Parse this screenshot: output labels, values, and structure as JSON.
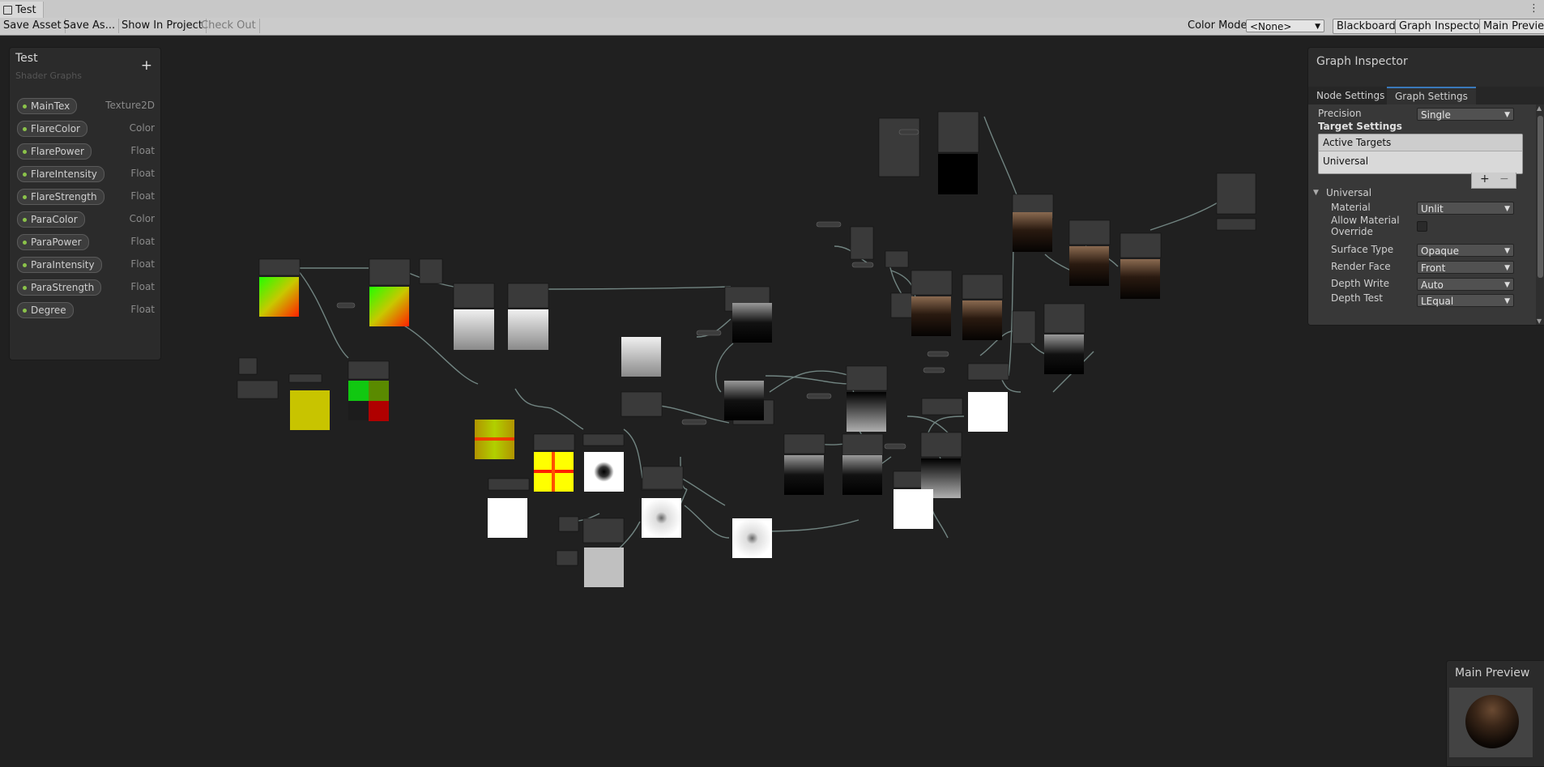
{
  "window": {
    "tab_title": "Test"
  },
  "toolbar": {
    "save_asset": "Save Asset",
    "save_as": "Save As...",
    "show_in_project": "Show In Project",
    "check_out": "Check Out",
    "color_mode_label": "Color Mode",
    "color_mode_value": "<None>",
    "blackboard": "Blackboard",
    "graph_inspector": "Graph Inspector",
    "main_preview": "Main Preview"
  },
  "blackboard": {
    "title": "Test",
    "subtitle": "Shader Graphs",
    "add": "+",
    "properties": [
      {
        "name": "MainTex",
        "type": "Texture2D"
      },
      {
        "name": "FlareColor",
        "type": "Color"
      },
      {
        "name": "FlarePower",
        "type": "Float"
      },
      {
        "name": "FlareIntensity",
        "type": "Float"
      },
      {
        "name": "FlareStrength",
        "type": "Float"
      },
      {
        "name": "ParaColor",
        "type": "Color"
      },
      {
        "name": "ParaPower",
        "type": "Float"
      },
      {
        "name": "ParaIntensity",
        "type": "Float"
      },
      {
        "name": "ParaStrength",
        "type": "Float"
      },
      {
        "name": "Degree",
        "type": "Float"
      }
    ]
  },
  "inspector": {
    "title": "Graph Inspector",
    "tabs": [
      "Node Settings",
      "Graph Settings"
    ],
    "active_tab": "Graph Settings",
    "precision_label": "Precision",
    "precision_value": "Single",
    "target_settings": "Target Settings",
    "active_targets": "Active Targets",
    "target_item": "Universal",
    "plus": "+",
    "minus": "−",
    "section": "Universal",
    "fields": [
      {
        "label": "Material",
        "value": "Unlit"
      },
      {
        "label": "Allow Material Override",
        "value": ""
      },
      {
        "label": "Surface Type",
        "value": "Opaque"
      },
      {
        "label": "Render Face",
        "value": "Front"
      },
      {
        "label": "Depth Write",
        "value": "Auto"
      },
      {
        "label": "Depth Test",
        "value": "LEqual"
      }
    ],
    "allow_override_checked": false
  },
  "preview": {
    "title": "Main Preview"
  },
  "colors": {
    "canvas": "#202020",
    "panel": "#2b2b2b",
    "edge": "#6e8f8a",
    "accent": "#3a79bb",
    "property_dot": "#8bc34a"
  }
}
